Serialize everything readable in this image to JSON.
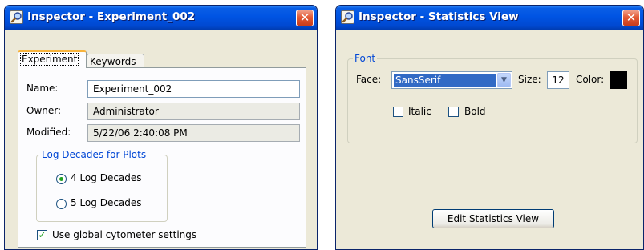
{
  "experiment_inspector": {
    "title": "Inspector - Experiment_002",
    "tabs": [
      {
        "label": "Experiment",
        "active": true
      },
      {
        "label": "Keywords",
        "active": false
      }
    ],
    "fields": {
      "name_label": "Name:",
      "name_value": "Experiment_002",
      "owner_label": "Owner:",
      "owner_value": "Administrator",
      "modified_label": "Modified:",
      "modified_value": "5/22/06 2:40:08 PM"
    },
    "log_decades": {
      "legend": "Log Decades for Plots",
      "options": [
        {
          "label": "4 Log Decades",
          "selected": true
        },
        {
          "label": "5 Log Decades",
          "selected": false
        }
      ]
    },
    "global_settings": {
      "label": "Use global cytometer settings",
      "checked": true
    }
  },
  "statistics_inspector": {
    "title": "Inspector - Statistics View",
    "font_group": {
      "legend": "Font",
      "face_label": "Face:",
      "face_value": "SansSerif",
      "size_label": "Size:",
      "size_value": "12",
      "color_label": "Color:",
      "color_value": "#000000",
      "italic_label": "Italic",
      "italic_checked": false,
      "bold_label": "Bold",
      "bold_checked": false
    },
    "edit_button": "Edit Statistics View"
  },
  "icons": {
    "window_icon": "inspector-magnifier-icon",
    "close_icon": "close-x-icon"
  },
  "colors": {
    "titlebar": "#0054e3",
    "close": "#e35a35",
    "accent_legend": "#0046d5",
    "selection": "#316ac5"
  }
}
